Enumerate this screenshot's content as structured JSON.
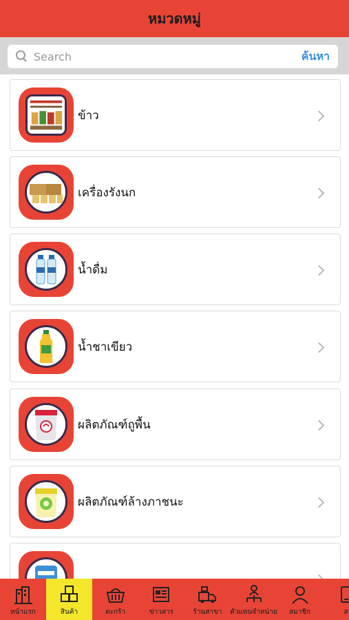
{
  "header": {
    "title": "หมวดหมู่"
  },
  "search": {
    "placeholder": "Search",
    "button_label": "ค้นหา"
  },
  "categories": [
    {
      "label": "ข้าว",
      "icon": "rice-product-icon"
    },
    {
      "label": "เครื่องรังนก",
      "icon": "birdnest-product-icon"
    },
    {
      "label": "น้ำดื่ม",
      "icon": "drinking-water-icon"
    },
    {
      "label": "น้ำชาเขียว",
      "icon": "green-tea-icon"
    },
    {
      "label": "ผลิตภัณฑ์ถูพื้น",
      "icon": "floor-cleaner-icon"
    },
    {
      "label": "ผลิตภัณฑ์ล้างภาชนะ",
      "icon": "dish-soap-icon"
    },
    {
      "label": "",
      "icon": "product-icon"
    }
  ],
  "tabs": [
    {
      "label": "หน้าแรก",
      "icon": "home-icon",
      "active": false
    },
    {
      "label": "สินค้า",
      "icon": "products-icon",
      "active": true
    },
    {
      "label": "ตะกร้า",
      "icon": "basket-icon",
      "active": false
    },
    {
      "label": "ข่าวสาร",
      "icon": "news-icon",
      "active": false
    },
    {
      "label": "ร้านสาขา",
      "icon": "branch-store-icon",
      "active": false
    },
    {
      "label": "ตัวแทนจำหน่าย",
      "icon": "dealer-icon",
      "active": false
    },
    {
      "label": "สมาชิก",
      "icon": "member-icon",
      "active": false
    },
    {
      "label": "ส",
      "icon": "more-icon",
      "active": false
    }
  ],
  "colors": {
    "primary": "#e84436",
    "active_tab": "#f4e62b",
    "link": "#3b8fe0"
  }
}
